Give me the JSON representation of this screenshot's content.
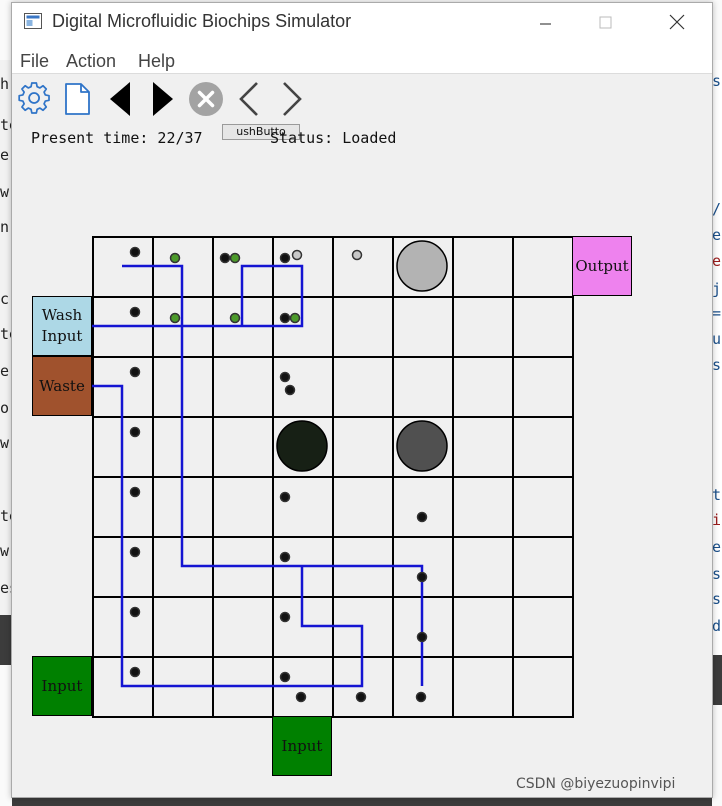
{
  "window": {
    "title": "Digital Microfluidic Biochips Simulator",
    "controls": [
      "minimize",
      "maximize",
      "close"
    ]
  },
  "menu": {
    "items": [
      "File",
      "Action",
      "Help"
    ]
  },
  "toolbar": {
    "buttons": [
      {
        "name": "settings",
        "icon": "gear-icon"
      },
      {
        "name": "new-file",
        "icon": "document-icon"
      },
      {
        "name": "step-back",
        "icon": "triangle-left-icon"
      },
      {
        "name": "step-forward",
        "icon": "triangle-right-icon"
      },
      {
        "name": "stop",
        "icon": "close-circle-icon"
      },
      {
        "name": "previous",
        "icon": "chevron-left-icon"
      },
      {
        "name": "next",
        "icon": "chevron-right-icon"
      }
    ],
    "push_button_label": "PushButton",
    "push_button_visible_text": "ushButto"
  },
  "status": {
    "present_time_label": "Present time:",
    "present_time_value": "22/37",
    "present_time_text": "Present time: 22/37",
    "status_label": "Status:",
    "status_value": "Loaded",
    "status_text": "Status: Loaded"
  },
  "chip": {
    "rows": 8,
    "cols": 8,
    "ports": [
      {
        "label": "Output",
        "color": "#ee82ee",
        "side": "right",
        "row": 0
      },
      {
        "label": "Wash\nInput",
        "color": "#add8e6",
        "side": "left",
        "row": 1
      },
      {
        "label": "Waste",
        "color": "#a0522d",
        "side": "left",
        "row": 2
      },
      {
        "label": "Input",
        "color": "#008000",
        "side": "left",
        "row": 7
      },
      {
        "label": "Input",
        "color": "#008000",
        "side": "bottom",
        "col": 3
      }
    ],
    "droplets": [
      {
        "row": 0,
        "col": 5,
        "size": "large",
        "color": "#b3b3b3"
      },
      {
        "row": 3,
        "col": 3,
        "size": "large",
        "color": "#172015"
      },
      {
        "row": 3,
        "col": 5,
        "size": "large",
        "color": "#505050"
      }
    ],
    "route_color": "#1414d2",
    "marker_colors": {
      "dark": "#111111",
      "green": "#4c9a2a",
      "grey": "#c8c8c8"
    }
  },
  "background": {
    "left_chars": [
      "h",
      "te",
      "e.",
      "w",
      "n",
      "c",
      "te",
      "e.",
      "o",
      "w",
      "te",
      "w",
      "es"
    ],
    "right_chars": [
      "s",
      "/",
      "e",
      "e",
      "j",
      "=",
      "u",
      "s",
      "t",
      "i",
      "e",
      "s",
      "s",
      "d"
    ]
  },
  "watermark": "CSDN @biyezuopinvipi"
}
